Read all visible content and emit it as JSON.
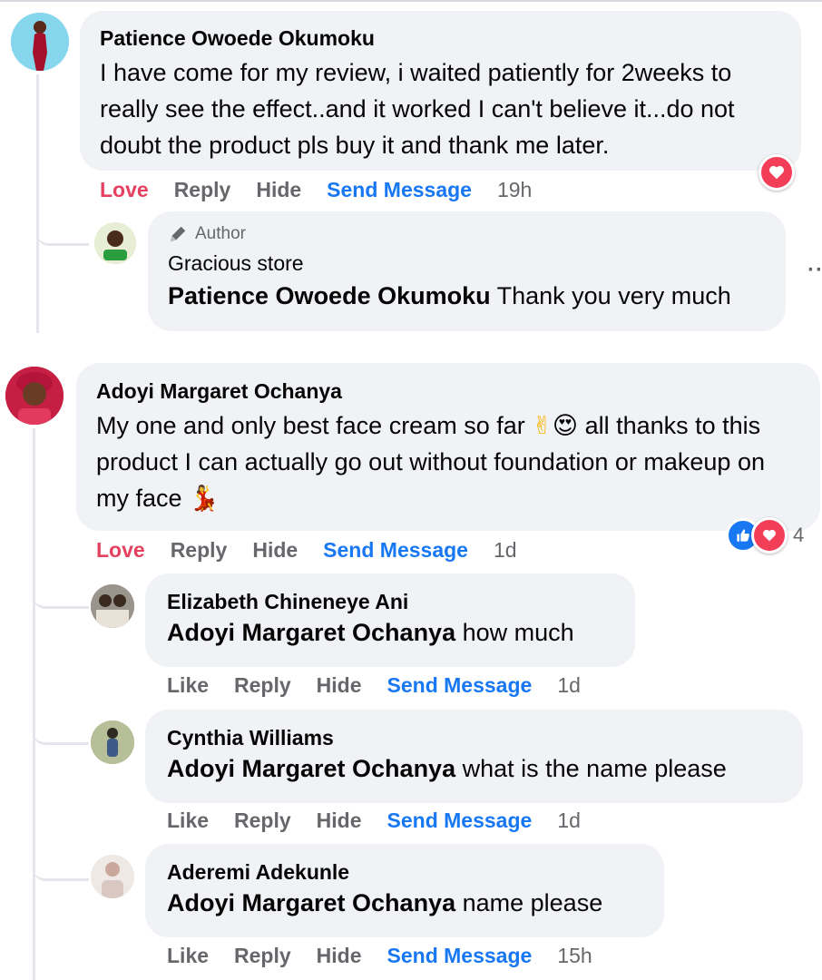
{
  "comments": [
    {
      "name": "Patience Owoede Okumoku",
      "text": "I have come for my review, i waited patiently for 2weeks to really see the effect..and it worked I can't believe it...do not doubt the product pls buy it and thank me later.",
      "actions": {
        "react": "Love",
        "reply": "Reply",
        "hide": "Hide",
        "send": "Send Message",
        "time": "19h"
      },
      "reply": {
        "badge": "Author",
        "name": "Gracious store",
        "mention": "Patience Owoede Okumoku",
        "text": "Thank you very much"
      }
    },
    {
      "name": "Adoyi Margaret Ochanya",
      "text1": "My one and only best face cream so far",
      "emoji1": "✌",
      "emoji2": "😍",
      "text2": "all thanks to this product I can actually go out without foundation or makeup on my face",
      "emoji3": "💃",
      "actions": {
        "react": "Love",
        "reply": "Reply",
        "hide": "Hide",
        "send": "Send Message",
        "time": "1d"
      },
      "reaction_count": "4",
      "replies": [
        {
          "name": "Elizabeth Chineneye Ani",
          "mention": "Adoyi Margaret Ochanya",
          "text": "how much",
          "actions": {
            "react": "Like",
            "reply": "Reply",
            "hide": "Hide",
            "send": "Send Message",
            "time": "1d"
          }
        },
        {
          "name": "Cynthia Williams",
          "mention": "Adoyi Margaret Ochanya",
          "text": "what is the name please",
          "actions": {
            "react": "Like",
            "reply": "Reply",
            "hide": "Hide",
            "send": "Send Message",
            "time": "1d"
          }
        },
        {
          "name": "Aderemi Adekunle",
          "mention": "Adoyi Margaret Ochanya",
          "text": "name please",
          "actions": {
            "react": "Like",
            "reply": "Reply",
            "hide": "Hide",
            "send": "Send Message",
            "time": "15h"
          }
        }
      ]
    }
  ],
  "icons": {
    "heart": "heart-icon",
    "like": "thumbs-up-icon",
    "pen": "pen-icon",
    "more": "more-options-icon"
  },
  "colors": {
    "love": "#e4405f",
    "link": "#1877f2",
    "bubble": "#f0f2f5",
    "muted": "#65676b"
  }
}
